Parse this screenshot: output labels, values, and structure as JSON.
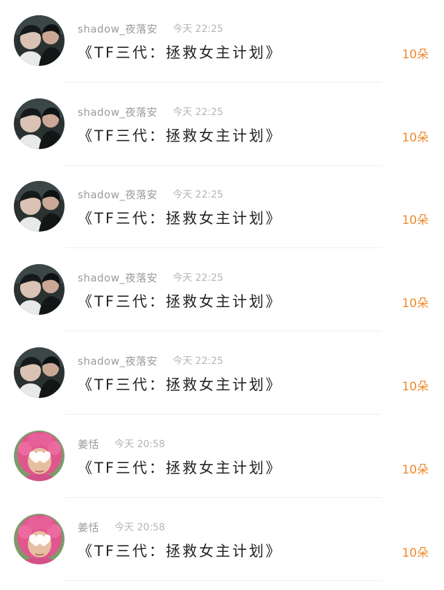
{
  "comments": [
    {
      "username": "shadow_夜落安",
      "time": "今天 22:25",
      "message": "《TF三代：拯救女主计划》",
      "amount": "10朵",
      "avatar": "photo-two-boys"
    },
    {
      "username": "shadow_夜落安",
      "time": "今天 22:25",
      "message": "《TF三代：拯救女主计划》",
      "amount": "10朵",
      "avatar": "photo-two-boys"
    },
    {
      "username": "shadow_夜落安",
      "time": "今天 22:25",
      "message": "《TF三代：拯救女主计划》",
      "amount": "10朵",
      "avatar": "photo-two-boys"
    },
    {
      "username": "shadow_夜落安",
      "time": "今天 22:25",
      "message": "《TF三代：拯救女主计划》",
      "amount": "10朵",
      "avatar": "photo-two-boys"
    },
    {
      "username": "shadow_夜落安",
      "time": "今天 22:25",
      "message": "《TF三代：拯救女主计划》",
      "amount": "10朵",
      "avatar": "photo-two-boys"
    },
    {
      "username": "姜恬",
      "time": "今天 20:58",
      "message": "《TF三代：拯救女主计划》",
      "amount": "10朵",
      "avatar": "photo-pink-hair-heart-glasses"
    },
    {
      "username": "姜恬",
      "time": "今天 20:58",
      "message": "《TF三代：拯救女主计划》",
      "amount": "10朵",
      "avatar": "photo-pink-hair-heart-glasses"
    }
  ],
  "colors": {
    "amount": "#f08a2e",
    "username": "#9a9a9a",
    "time": "#b4b4b4",
    "message": "#222222",
    "divider": "#eeeeee",
    "background": "#ffffff"
  }
}
